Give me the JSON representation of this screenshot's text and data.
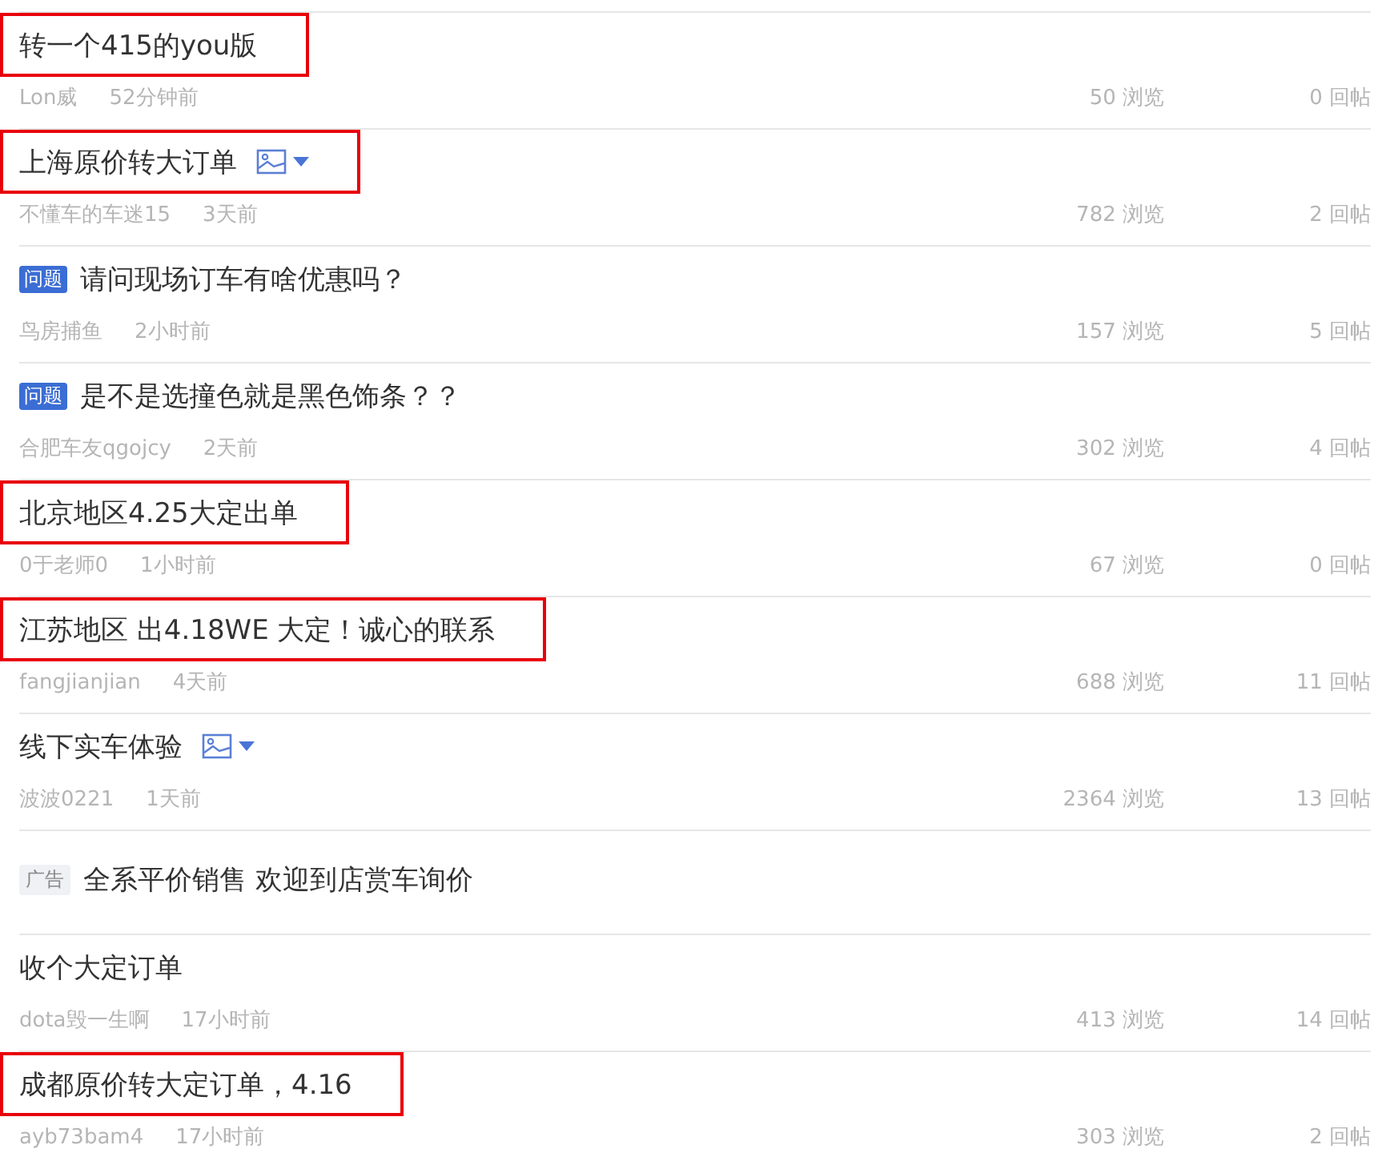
{
  "posts": [
    {
      "title": "转一个415的you版",
      "has_image": false,
      "highlighted": true,
      "author": "Lon威",
      "time": "52分钟前",
      "views": "50 浏览",
      "replies": "0 回帖"
    },
    {
      "title": "上海原价转大订单",
      "has_image": true,
      "highlighted": true,
      "author": "不懂车的车迷15",
      "time": "3天前",
      "views": "782 浏览",
      "replies": "2 回帖"
    },
    {
      "title": "请问现场订车有啥优惠吗？",
      "tag": {
        "kind": "question",
        "label": "问题"
      },
      "has_image": false,
      "highlighted": false,
      "author": "鸟房捕鱼",
      "time": "2小时前",
      "views": "157 浏览",
      "replies": "5 回帖"
    },
    {
      "title": "是不是选撞色就是黑色饰条？？",
      "tag": {
        "kind": "question",
        "label": "问题"
      },
      "has_image": false,
      "highlighted": false,
      "author": "合肥车友qgojcy",
      "time": "2天前",
      "views": "302 浏览",
      "replies": "4 回帖"
    },
    {
      "title": "北京地区4.25大定出单",
      "has_image": false,
      "highlighted": true,
      "author": "0于老师0",
      "time": "1小时前",
      "views": "67 浏览",
      "replies": "0 回帖"
    },
    {
      "title": "江苏地区 出4.18WE 大定！诚心的联系",
      "has_image": false,
      "highlighted": true,
      "author": "fangjianjian",
      "time": "4天前",
      "views": "688 浏览",
      "replies": "11 回帖"
    },
    {
      "title": "线下实车体验",
      "has_image": true,
      "highlighted": false,
      "author": "波波0221",
      "time": "1天前",
      "views": "2364 浏览",
      "replies": "13 回帖"
    },
    {
      "title": "全系平价销售 欢迎到店赏车询价",
      "tag": {
        "kind": "ad",
        "label": "广告"
      },
      "has_image": false,
      "highlighted": false
    },
    {
      "title": "收个大定订单",
      "has_image": false,
      "highlighted": false,
      "author": "dota毁一生啊",
      "time": "17小时前",
      "views": "413 浏览",
      "replies": "14 回帖"
    },
    {
      "title": "成都原价转大定订单，4.16",
      "has_image": false,
      "highlighted": true,
      "author": "ayb73bam4",
      "time": "17小时前",
      "views": "303 浏览",
      "replies": "2 回帖"
    }
  ]
}
